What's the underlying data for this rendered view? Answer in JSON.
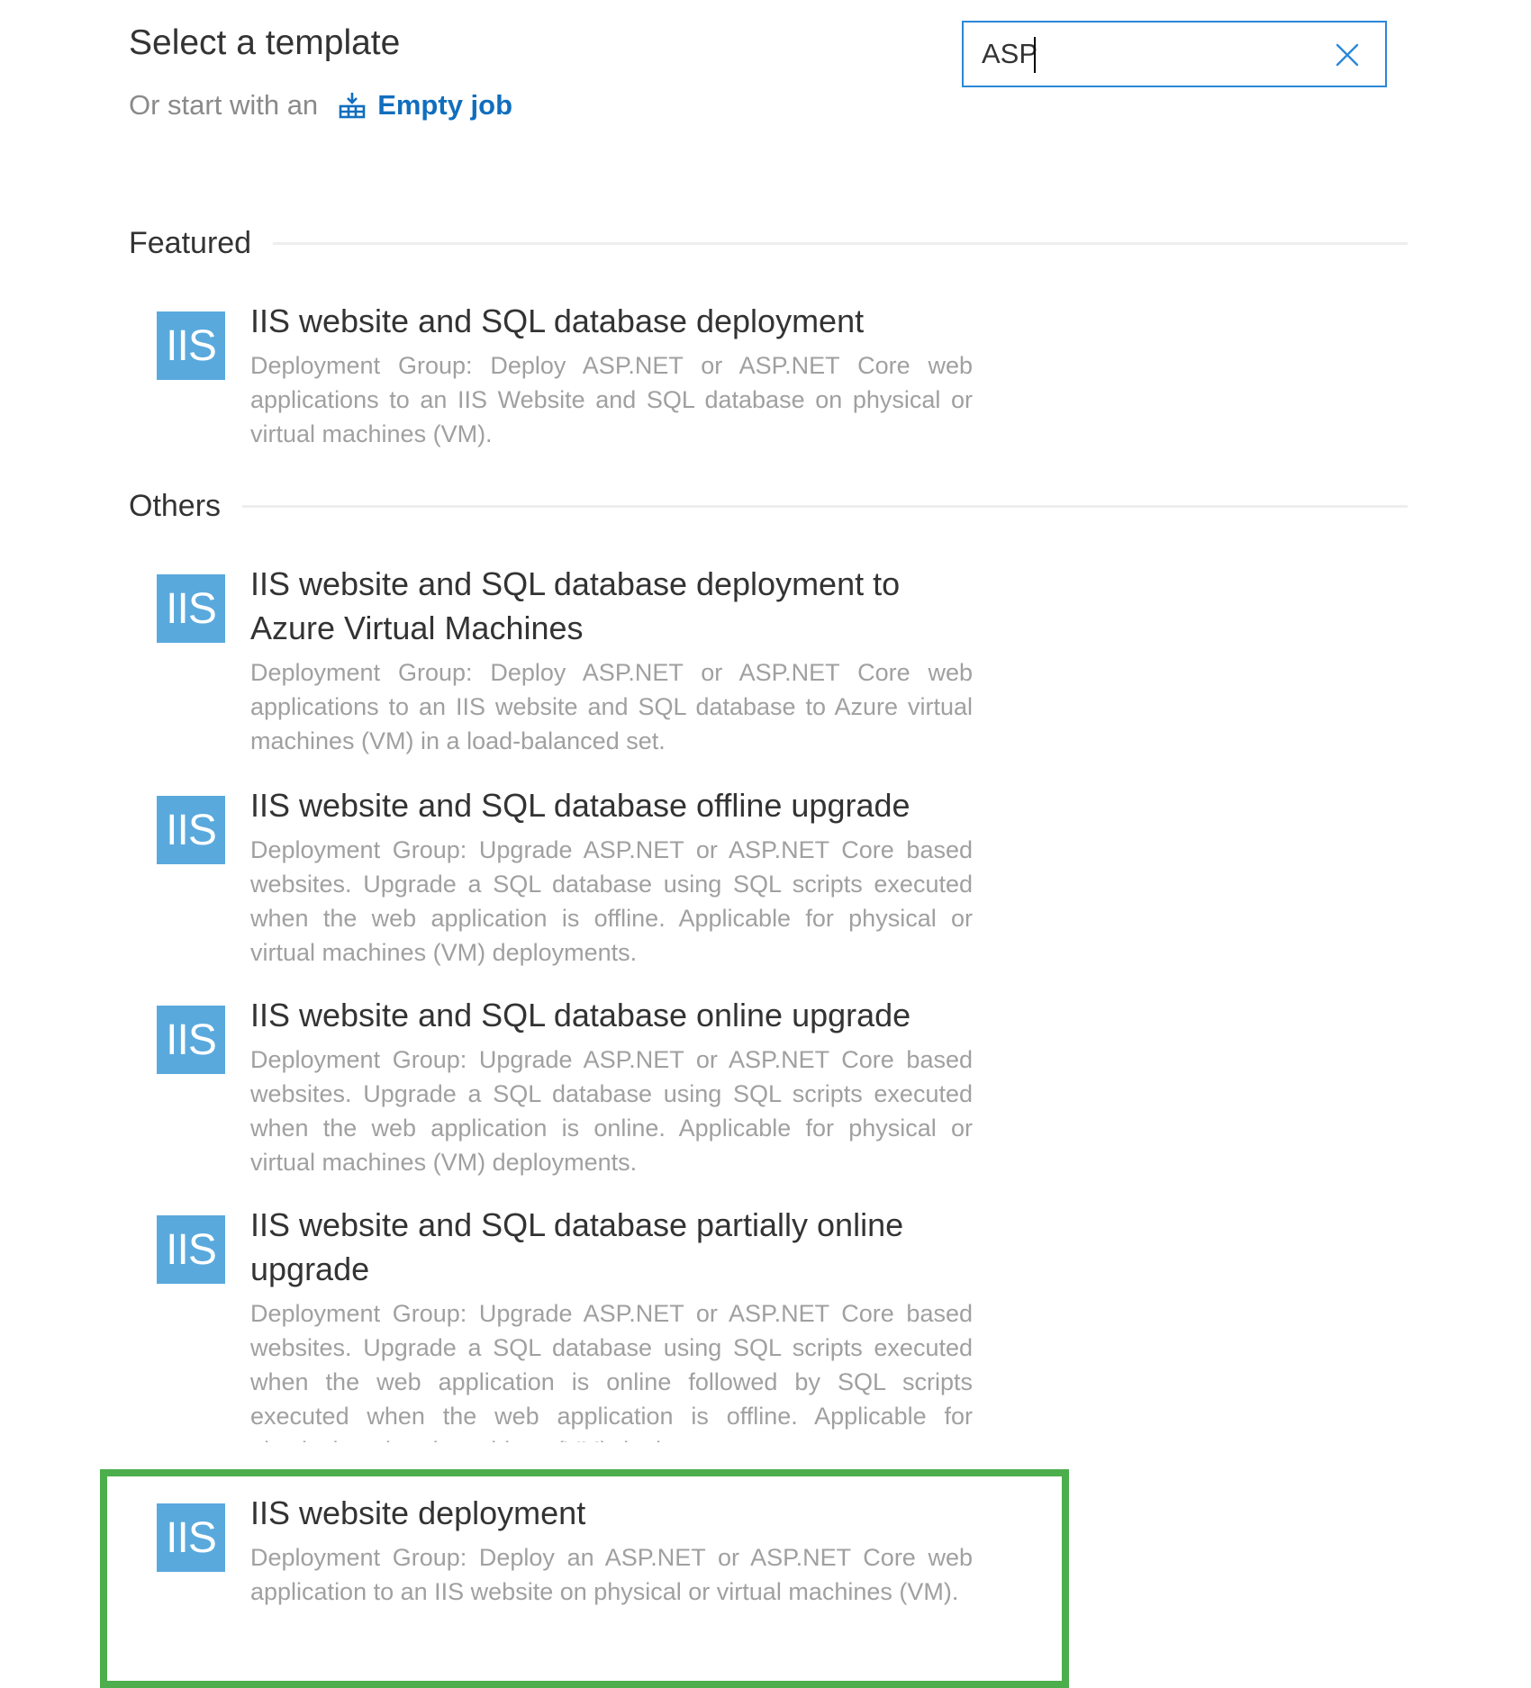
{
  "header": {
    "title": "Select a template",
    "start_text": "Or start with an",
    "empty_job_label": "Empty job",
    "empty_job_icon": "empty-job-icon"
  },
  "search": {
    "value": "ASP",
    "placeholder": "",
    "clear_icon": "close-icon"
  },
  "sections": {
    "featured": {
      "label": "Featured",
      "items": [
        {
          "icon_text": "IIS",
          "title": "IIS website and SQL database deployment",
          "description": "Deployment Group: Deploy ASP.NET or ASP.NET Core web applications to an IIS Website and SQL database on physical or virtual machines (VM)."
        }
      ]
    },
    "others": {
      "label": "Others",
      "items": [
        {
          "icon_text": "IIS",
          "title": "IIS website and SQL database deployment to Azure Virtual Machines",
          "description": "Deployment Group: Deploy ASP.NET or ASP.NET Core web applications to an IIS website and SQL database to Azure virtual machines (VM) in a load-balanced set."
        },
        {
          "icon_text": "IIS",
          "title": "IIS website and SQL database offline upgrade",
          "description": "Deployment Group: Upgrade ASP.NET or ASP.NET Core based websites. Upgrade a SQL database using SQL scripts executed when the web application is offline. Applicable for physical or virtual machines (VM) deployments."
        },
        {
          "icon_text": "IIS",
          "title": "IIS website and SQL database online upgrade",
          "description": "Deployment Group: Upgrade ASP.NET or ASP.NET Core based websites. Upgrade a SQL database using SQL scripts executed when the web application is online. Applicable for physical or virtual machines (VM) deployments."
        },
        {
          "icon_text": "IIS",
          "title": "IIS website and SQL database partially online upgrade",
          "description": "Deployment Group: Upgrade ASP.NET or ASP.NET Core based websites. Upgrade a SQL database using SQL scripts executed when the web application is online followed by SQL scripts executed when the web application is offline. Applicable for physical or virtual machines (VM) deployments."
        },
        {
          "icon_text": "IIS",
          "title": "IIS website deployment",
          "description": "Deployment Group: Deploy an ASP.NET or ASP.NET Core web application to an IIS website on physical or virtual machines (VM)."
        }
      ]
    }
  },
  "colors": {
    "accent": "#106ebe",
    "search_border": "#2b88d8",
    "icon_bg": "#59a9dd",
    "highlight": "#4cae4c"
  }
}
